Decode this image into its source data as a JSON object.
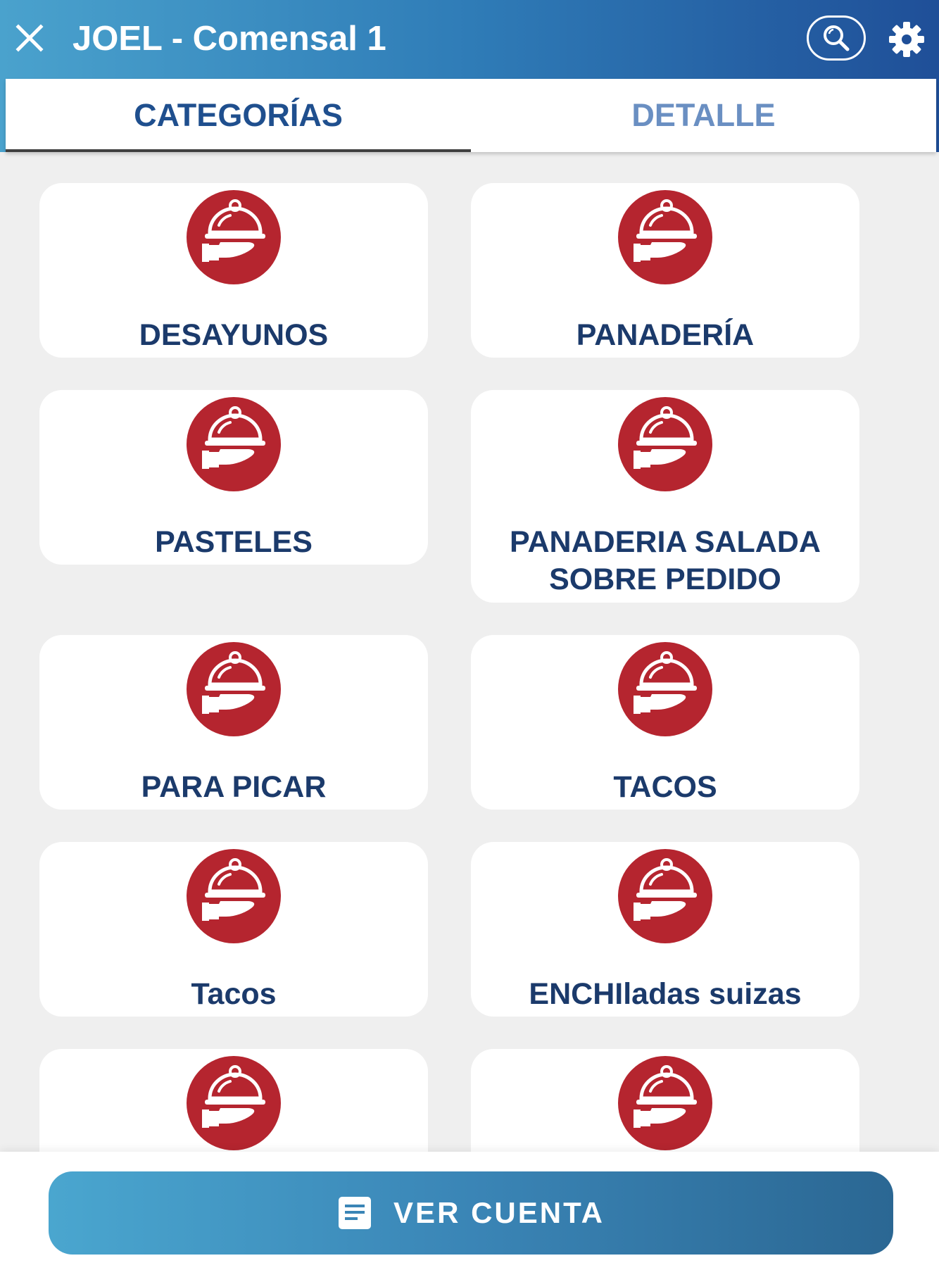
{
  "header": {
    "title": "JOEL - Comensal 1",
    "close_icon": "close-icon",
    "search_icon": "search-icon",
    "settings_icon": "gear-icon"
  },
  "tabs": [
    {
      "label": "CATEGORÍAS",
      "active": true
    },
    {
      "label": "DETALLE",
      "active": false
    }
  ],
  "categories": [
    {
      "label": "DESAYUNOS",
      "icon": "serving-tray-icon"
    },
    {
      "label": "PANADERÍA",
      "icon": "serving-tray-icon"
    },
    {
      "label": "PASTELES",
      "icon": "serving-tray-icon"
    },
    {
      "label": "PANADERIA SALADA SOBRE PEDIDO",
      "icon": "serving-tray-icon"
    },
    {
      "label": "PARA PICAR",
      "icon": "serving-tray-icon"
    },
    {
      "label": "TACOS",
      "icon": "serving-tray-icon"
    },
    {
      "label": "Tacos",
      "icon": "serving-tray-icon"
    },
    {
      "label": "ENCHIladas suizas",
      "icon": "serving-tray-icon"
    },
    {
      "label": "",
      "icon": "serving-tray-icon"
    },
    {
      "label": "",
      "icon": "serving-tray-icon"
    }
  ],
  "footer": {
    "button_label": "VER CUENTA",
    "button_icon": "document-icon"
  },
  "colors": {
    "header_gradient_start": "#4aa2cd",
    "header_gradient_end": "#1f4f98",
    "icon_red": "#b5252f",
    "label_navy": "#1b3a6b",
    "active_tab": "#1f4f8e",
    "inactive_tab": "#6a8fc2"
  }
}
